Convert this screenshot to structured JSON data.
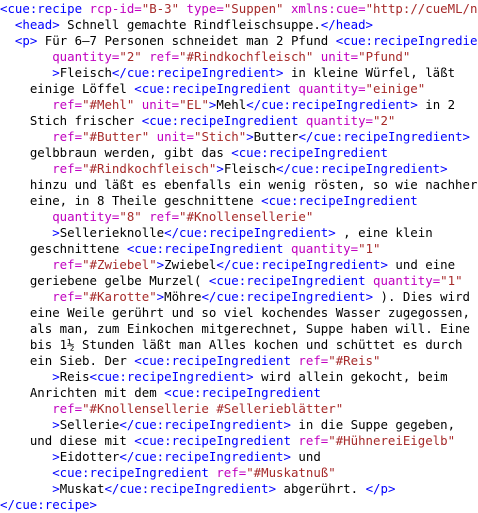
{
  "editor": {
    "colors": {
      "tag": "#0000ff",
      "attr_name": "#c000c0",
      "attr_value": "#a62a2a",
      "text": "#000000",
      "background": "#ffffff"
    },
    "lines": [
      {
        "indent": 0,
        "segs": [
          [
            "t",
            "<cue:recipe "
          ],
          [
            "a",
            "rcp-id="
          ],
          [
            "v",
            "\"B-3\" "
          ],
          [
            "a",
            "type="
          ],
          [
            "v",
            "\"Suppen\" "
          ],
          [
            "a",
            "xmlns:cue="
          ],
          [
            "v",
            "\"http://cueML/ns\""
          ],
          [
            "t",
            ">"
          ]
        ]
      },
      {
        "indent": 2,
        "segs": [
          [
            "t",
            "<head>"
          ],
          [
            "x",
            " Schnell gemachte Rindfleischsuppe."
          ],
          [
            "t",
            "</head>"
          ]
        ]
      },
      {
        "indent": 2,
        "segs": [
          [
            "t",
            "<p>"
          ],
          [
            "x",
            " Für 6–7 Personen schneidet man 2 Pfund "
          ],
          [
            "t",
            "<cue:recipeIngredient"
          ]
        ]
      },
      {
        "indent": 7,
        "segs": [
          [
            "a",
            "quantity="
          ],
          [
            "v",
            "\"2\" "
          ],
          [
            "a",
            "ref="
          ],
          [
            "v",
            "\"#Rindkochfleisch\" "
          ],
          [
            "a",
            "unit="
          ],
          [
            "v",
            "\"Pfund\""
          ]
        ]
      },
      {
        "indent": 7,
        "segs": [
          [
            "t",
            ">"
          ],
          [
            "x",
            "Fleisch"
          ],
          [
            "t",
            "</cue:recipeIngredient>"
          ],
          [
            "x",
            " in kleine Würfel, läßt"
          ]
        ]
      },
      {
        "indent": 4,
        "segs": [
          [
            "x",
            "einige Löffel "
          ],
          [
            "t",
            "<cue:recipeIngredient "
          ],
          [
            "a",
            "quantity="
          ],
          [
            "v",
            "\"einige\""
          ]
        ]
      },
      {
        "indent": 7,
        "segs": [
          [
            "a",
            "ref="
          ],
          [
            "v",
            "\"#Mehl\" "
          ],
          [
            "a",
            "unit="
          ],
          [
            "v",
            "\"EL\""
          ],
          [
            "t",
            ">"
          ],
          [
            "x",
            "Mehl"
          ],
          [
            "t",
            "</cue:recipeIngredient>"
          ],
          [
            "x",
            " in 2"
          ]
        ]
      },
      {
        "indent": 4,
        "segs": [
          [
            "x",
            "Stich frischer "
          ],
          [
            "t",
            "<cue:recipeIngredient "
          ],
          [
            "a",
            "quantity="
          ],
          [
            "v",
            "\"2\""
          ]
        ]
      },
      {
        "indent": 7,
        "segs": [
          [
            "a",
            "ref="
          ],
          [
            "v",
            "\"#Butter\" "
          ],
          [
            "a",
            "unit="
          ],
          [
            "v",
            "\"Stich\""
          ],
          [
            "t",
            ">"
          ],
          [
            "x",
            "Butter"
          ],
          [
            "t",
            "</cue:recipeIngredient>"
          ]
        ]
      },
      {
        "indent": 4,
        "segs": [
          [
            "x",
            "gelbbraun werden, gibt das "
          ],
          [
            "t",
            "<cue:recipeIngredient"
          ]
        ]
      },
      {
        "indent": 7,
        "segs": [
          [
            "a",
            "ref="
          ],
          [
            "v",
            "\"#Rindkochfleisch\""
          ],
          [
            "t",
            ">"
          ],
          [
            "x",
            "Fleisch"
          ],
          [
            "t",
            "</cue:recipeIngredient>"
          ]
        ]
      },
      {
        "indent": 4,
        "segs": [
          [
            "x",
            "hinzu und läßt es ebenfalls ein wenig rösten, so wie nachher"
          ]
        ]
      },
      {
        "indent": 4,
        "segs": [
          [
            "x",
            "eine, in 8 Theile geschnittene "
          ],
          [
            "t",
            "<cue:recipeIngredient"
          ]
        ]
      },
      {
        "indent": 7,
        "segs": [
          [
            "a",
            "quantity="
          ],
          [
            "v",
            "\"8\" "
          ],
          [
            "a",
            "ref="
          ],
          [
            "v",
            "\"#Knollensellerie\""
          ]
        ]
      },
      {
        "indent": 7,
        "segs": [
          [
            "t",
            ">"
          ],
          [
            "x",
            "Sellerieknolle"
          ],
          [
            "t",
            "</cue:recipeIngredient>"
          ],
          [
            "x",
            " , eine klein"
          ]
        ]
      },
      {
        "indent": 4,
        "segs": [
          [
            "x",
            "geschnittene "
          ],
          [
            "t",
            "<cue:recipeIngredient "
          ],
          [
            "a",
            "quantity="
          ],
          [
            "v",
            "\"1\""
          ]
        ]
      },
      {
        "indent": 7,
        "segs": [
          [
            "a",
            "ref="
          ],
          [
            "v",
            "\"#Zwiebel\""
          ],
          [
            "t",
            ">"
          ],
          [
            "x",
            "Zwiebel"
          ],
          [
            "t",
            "</cue:recipeIngredient>"
          ],
          [
            "x",
            " und eine"
          ]
        ]
      },
      {
        "indent": 4,
        "segs": [
          [
            "x",
            "geriebene gelbe Murzel( "
          ],
          [
            "t",
            "<cue:recipeIngredient "
          ],
          [
            "a",
            "quantity="
          ],
          [
            "v",
            "\"1\""
          ]
        ]
      },
      {
        "indent": 7,
        "segs": [
          [
            "a",
            "ref="
          ],
          [
            "v",
            "\"#Karotte\""
          ],
          [
            "t",
            ">"
          ],
          [
            "x",
            "Möhre"
          ],
          [
            "t",
            "</cue:recipeIngredient>"
          ],
          [
            "x",
            " ). Dies wird"
          ]
        ]
      },
      {
        "indent": 4,
        "segs": [
          [
            "x",
            "eine Weile gerührt und so viel kochendes Wasser zugegossen,"
          ]
        ]
      },
      {
        "indent": 4,
        "segs": [
          [
            "x",
            "als man, zum Einkochen mitgerechnet, Suppe haben will. Eine"
          ]
        ]
      },
      {
        "indent": 4,
        "segs": [
          [
            "x",
            "bis 1½ Stunden läßt man Alles kochen und schüttet es durch"
          ]
        ]
      },
      {
        "indent": 4,
        "segs": [
          [
            "x",
            "ein Sieb. Der "
          ],
          [
            "t",
            "<cue:recipeIngredient "
          ],
          [
            "a",
            "ref="
          ],
          [
            "v",
            "\"#Reis\""
          ]
        ]
      },
      {
        "indent": 7,
        "segs": [
          [
            "t",
            ">"
          ],
          [
            "x",
            "Reis"
          ],
          [
            "t",
            "<cue:recipeIngredient>"
          ],
          [
            "x",
            " wird allein gekocht, beim"
          ]
        ]
      },
      {
        "indent": 4,
        "segs": [
          [
            "x",
            "Anrichten mit dem "
          ],
          [
            "t",
            "<cue:recipeIngredient"
          ]
        ]
      },
      {
        "indent": 7,
        "segs": [
          [
            "a",
            "ref="
          ],
          [
            "v",
            "\"#Knollensellerie #Sellerieblätter\""
          ]
        ]
      },
      {
        "indent": 7,
        "segs": [
          [
            "t",
            ">"
          ],
          [
            "x",
            "Sellerie"
          ],
          [
            "t",
            "</cue:recipeIngredient>"
          ],
          [
            "x",
            " in die Suppe gegeben,"
          ]
        ]
      },
      {
        "indent": 4,
        "segs": [
          [
            "x",
            "und diese mit "
          ],
          [
            "t",
            "<cue:recipeIngredient "
          ],
          [
            "a",
            "ref="
          ],
          [
            "v",
            "\"#HühnereiEigelb\""
          ]
        ]
      },
      {
        "indent": 7,
        "segs": [
          [
            "t",
            ">"
          ],
          [
            "x",
            "Eidotter"
          ],
          [
            "t",
            "</cue:recipeIngredient>"
          ],
          [
            "x",
            " und"
          ]
        ]
      },
      {
        "indent": 7,
        "segs": [
          [
            "t",
            "<cue:recipeIngredient "
          ],
          [
            "a",
            "ref="
          ],
          [
            "v",
            "\"#Muskatnuß\""
          ]
        ]
      },
      {
        "indent": 7,
        "segs": [
          [
            "t",
            ">"
          ],
          [
            "x",
            "Muskat"
          ],
          [
            "t",
            "</cue:recipeIngredient>"
          ],
          [
            "x",
            " abgerührt. "
          ],
          [
            "t",
            "</p>"
          ]
        ]
      },
      {
        "indent": 0,
        "segs": [
          [
            "t",
            "</cue:recipe>"
          ]
        ]
      }
    ]
  }
}
